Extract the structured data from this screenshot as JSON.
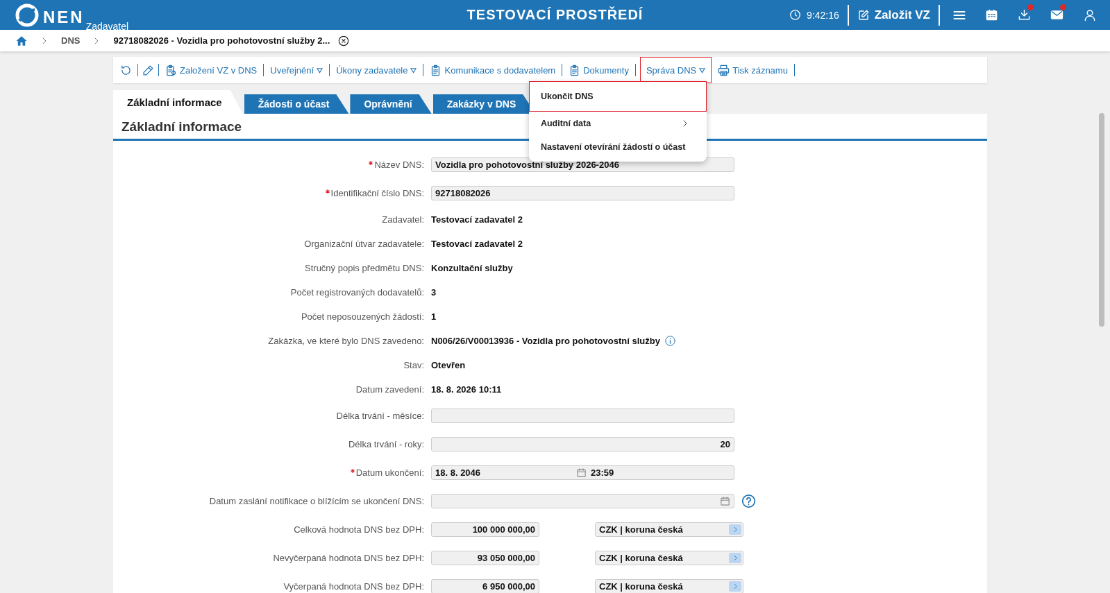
{
  "header": {
    "logo": "NEN",
    "subtitle": "Zadavatel",
    "title": "TESTOVACÍ PROSTŘEDÍ",
    "time": "9:42:16",
    "create_button": "Založit VZ",
    "download_notification": true,
    "mail_notification": true
  },
  "breadcrumb": [
    "DNS",
    "92718082026 - Vozidla pro pohotovostní služby 2..."
  ],
  "toolbar": [
    {
      "label": "Založení VZ v DNS",
      "dropdown": false,
      "open": false
    },
    {
      "label": "Uveřejnění",
      "dropdown": true,
      "open": false
    },
    {
      "label": "Úkony zadavatele",
      "dropdown": true,
      "open": false
    },
    {
      "label": "Komunikace s dodavatelem",
      "dropdown": false,
      "open": false
    },
    {
      "label": "Dokumenty",
      "dropdown": false,
      "open": false
    },
    {
      "label": "Správa DNS",
      "dropdown": true,
      "open": true
    },
    {
      "label": "Tisk záznamu",
      "dropdown": false,
      "open": false
    }
  ],
  "menu": [
    {
      "label": "Ukončit DNS",
      "selected": true,
      "submenu": false
    },
    {
      "label": "Auditní data",
      "selected": false,
      "submenu": true
    },
    {
      "label": "Nastavení otevírání žádostí o účast",
      "selected": false,
      "submenu": false
    }
  ],
  "tabs": [
    {
      "label": "Základní informace",
      "selected": true
    },
    {
      "label": "Žádosti o účast",
      "selected": false
    },
    {
      "label": "Oprávnění",
      "selected": false
    },
    {
      "label": "Zakázky v DNS",
      "selected": false
    }
  ],
  "section_title": "Základní informace",
  "fields": [
    {
      "kind": "input",
      "label": "Název DNS:",
      "required": true,
      "value": "Vozidla pro pohotovostní služby 2026-2046"
    },
    {
      "kind": "input",
      "label": "Identifikační číslo DNS:",
      "required": true,
      "value": "92718082026"
    },
    {
      "kind": "text",
      "label": "Zadavatel:",
      "required": false,
      "value": "Testovací zadavatel 2"
    },
    {
      "kind": "text",
      "label": "Organizační útvar zadavatele:",
      "required": false,
      "value": "Testovací zadavatel 2"
    },
    {
      "kind": "text",
      "label": "Stručný popis předmětu DNS:",
      "required": false,
      "value": "Konzultační služby"
    },
    {
      "kind": "text",
      "label": "Počet registrovaných dodavatelů:",
      "required": false,
      "value": "3"
    },
    {
      "kind": "text",
      "label": "Počet neposouzených žádostí:",
      "required": false,
      "value": "1"
    },
    {
      "kind": "text",
      "label": "Zakázka, ve které bylo DNS zavedeno:",
      "required": false,
      "value": "N006/26/V00013936 - Vozidla pro pohotovostní služby",
      "info": true
    },
    {
      "kind": "text",
      "label": "Stav:",
      "required": false,
      "value": "Otevřen"
    },
    {
      "kind": "text",
      "label": "Datum zavedení:",
      "required": false,
      "value": "18. 8. 2026 10:11"
    },
    {
      "kind": "number",
      "label": "Délka trvání - měsíce:",
      "required": false
    },
    {
      "kind": "number",
      "label": "Délka trvání - roky:",
      "required": false,
      "value": "20"
    },
    {
      "kind": "datetime",
      "label": "Datum ukončení:",
      "required": true,
      "value": "18. 8. 2046",
      "time": "23:59"
    },
    {
      "kind": "date",
      "label": "Datum zaslání notifikace o blížícím se ukončení DNS:",
      "required": false,
      "help": true
    },
    {
      "kind": "money",
      "label": "Celková hodnota DNS bez DPH:",
      "required": false,
      "value": "100 000 000,00",
      "currency": "CZK | koruna česká"
    },
    {
      "kind": "money",
      "label": "Nevyčerpaná hodnota DNS bez DPH:",
      "required": false,
      "value": "93 050 000,00",
      "currency": "CZK | koruna česká"
    },
    {
      "kind": "money",
      "label": "Vyčerpaná hodnota DNS bez DPH:",
      "required": false,
      "value": "6 950 000,00",
      "currency": "CZK | koruna česká"
    }
  ]
}
